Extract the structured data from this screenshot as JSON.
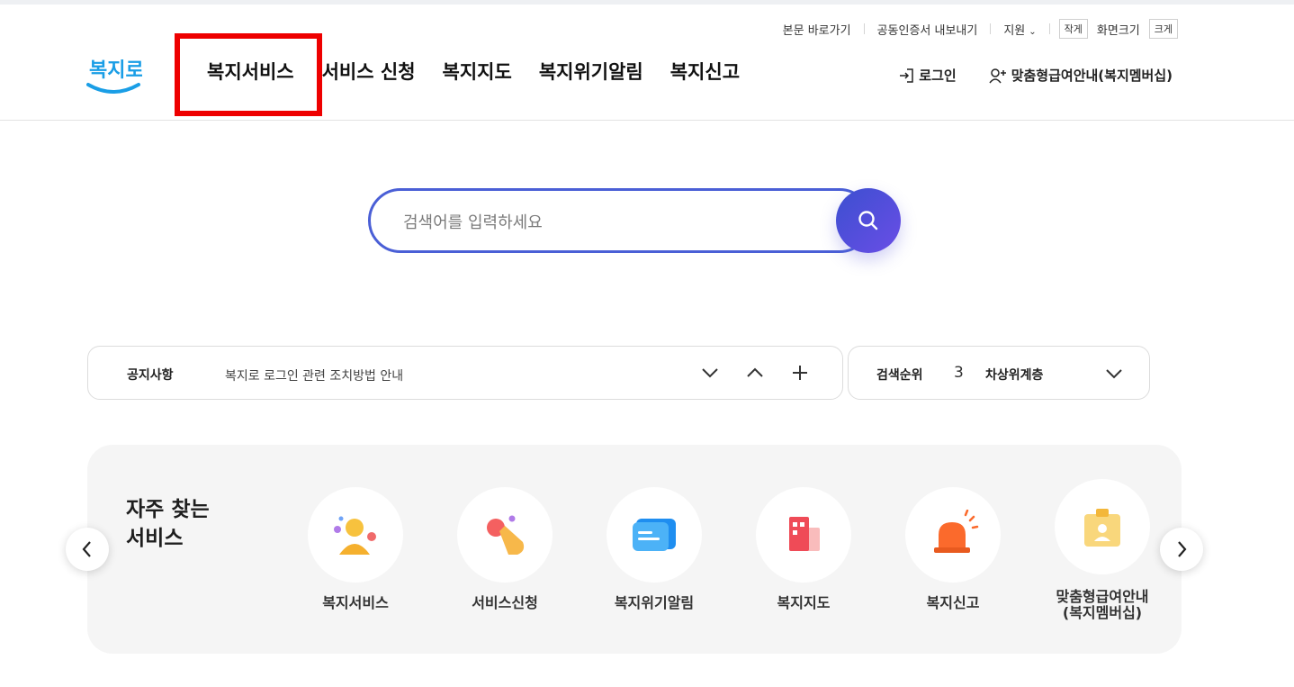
{
  "utility": {
    "skip_link": "본문 바로가기",
    "cert_export": "공동인증서 내보내기",
    "support": "지원",
    "smaller": "작게",
    "screen_size": "화면크기",
    "larger": "크게"
  },
  "logo": {
    "text": "복지로"
  },
  "nav": {
    "items": [
      "복지서비스",
      "서비스 신청",
      "복지지도",
      "복지위기알림",
      "복지신고"
    ]
  },
  "header_actions": {
    "login": "로그인",
    "membership": "맞춤형급여안내(복지멤버십)"
  },
  "search": {
    "placeholder": "검색어를 입력하세요"
  },
  "notice": {
    "title": "공지사항",
    "text": "복지로 로그인 관련 조치방법 안내"
  },
  "ranking": {
    "title": "검색순위",
    "rank": "3",
    "term": "차상위계층"
  },
  "quick": {
    "title_line1": "자주 찾는",
    "title_line2": "서비스",
    "services": [
      {
        "label": "복지서비스",
        "icon": "welfare-service-icon"
      },
      {
        "label": "서비스신청",
        "icon": "service-apply-icon"
      },
      {
        "label": "복지위기알림",
        "icon": "crisis-alert-message-icon"
      },
      {
        "label": "복지지도",
        "icon": "welfare-map-icon"
      },
      {
        "label": "복지신고",
        "icon": "siren-report-icon"
      },
      {
        "label_line1": "맞춤형급여안내",
        "label_line2": "(복지멤버십)",
        "icon": "membership-badge-icon"
      }
    ]
  },
  "colors": {
    "accent": "#4a5fd6",
    "highlight_box": "#ee0000",
    "logo_blue": "#1a9ee6"
  }
}
